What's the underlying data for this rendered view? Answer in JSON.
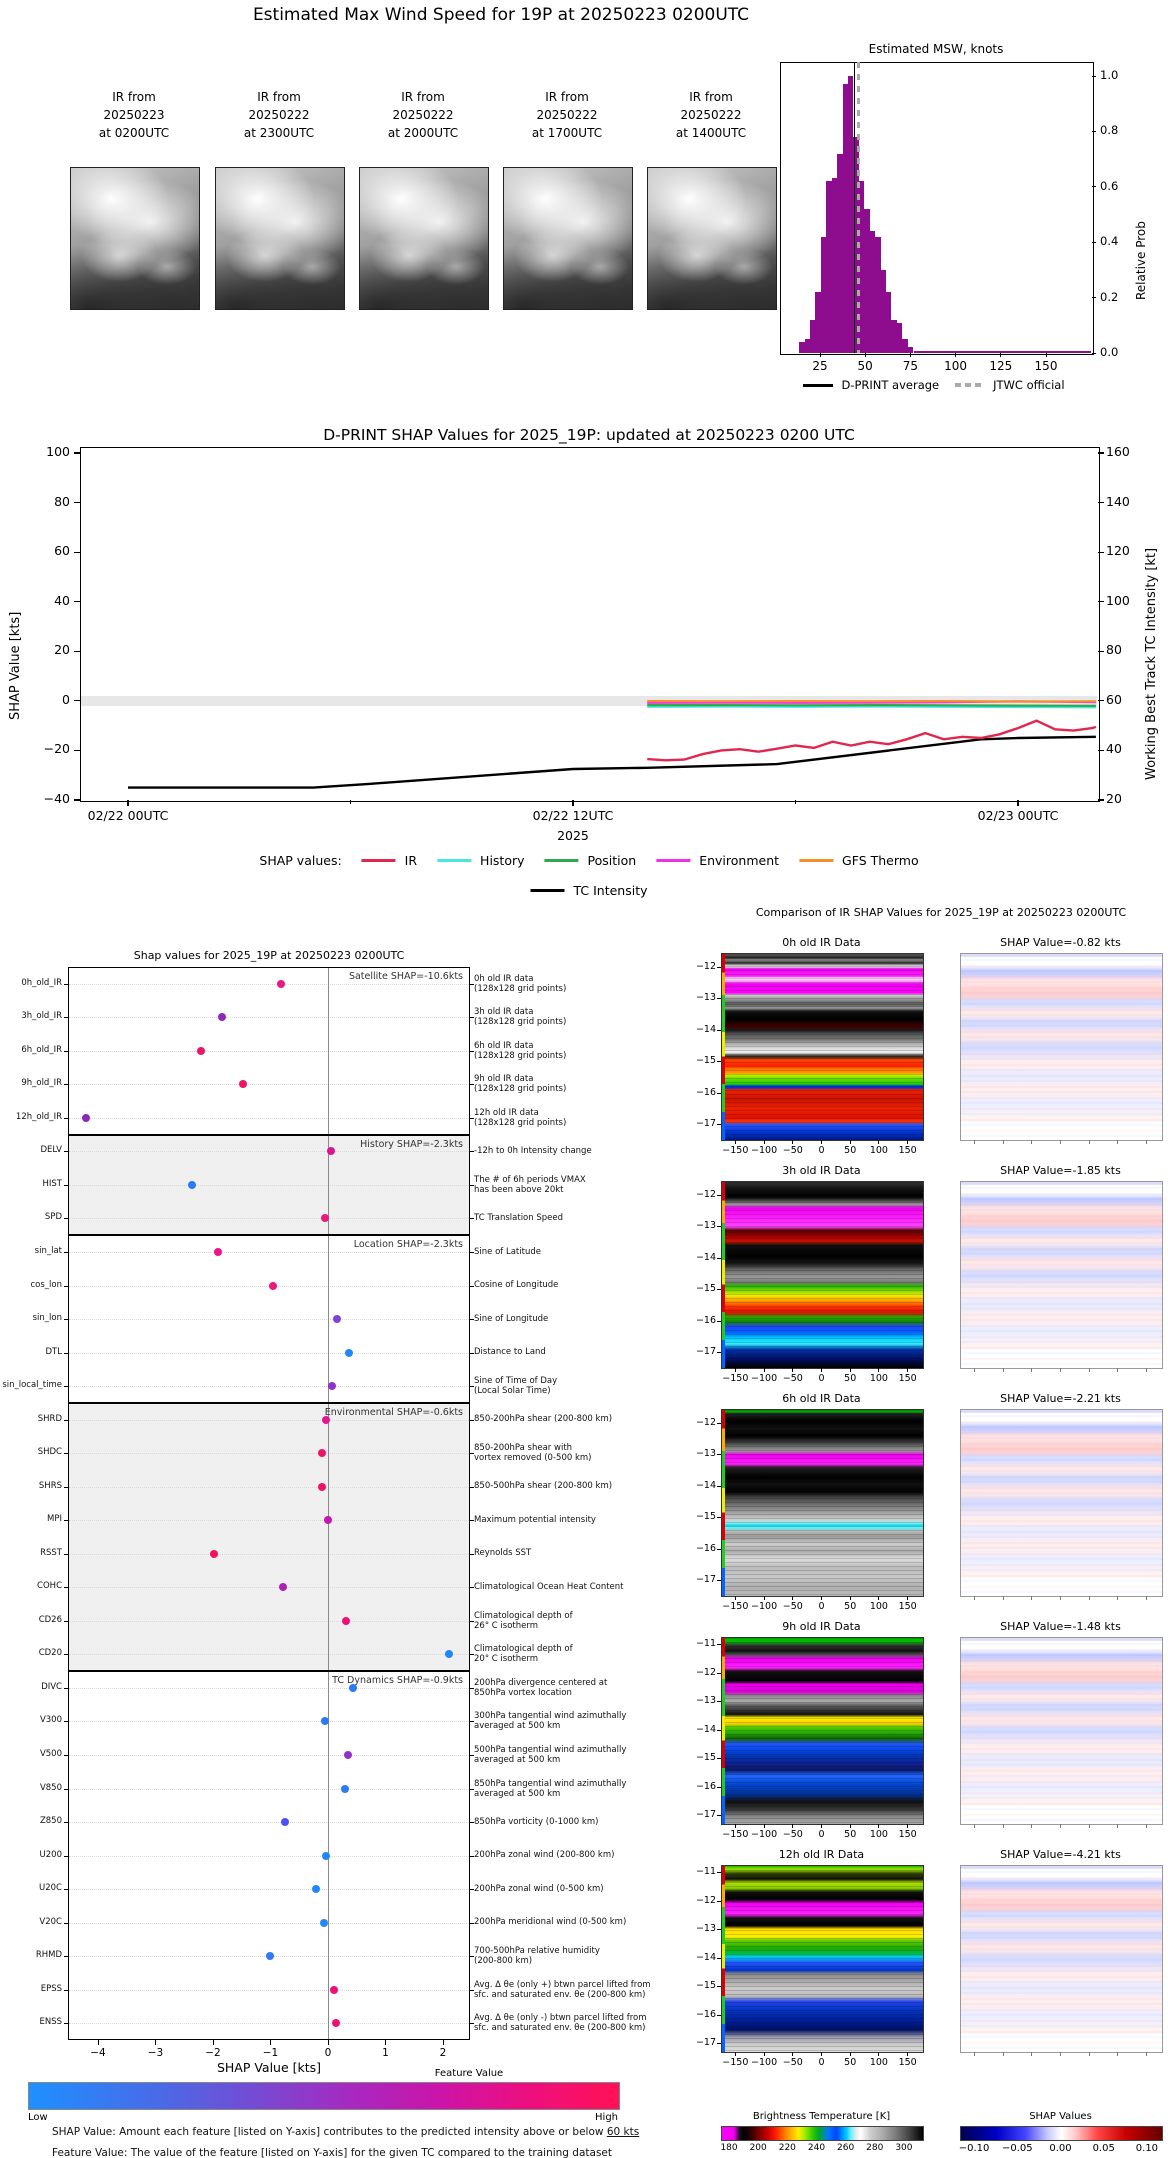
{
  "page": {
    "title": "Estimated Max Wind Speed for 19P at 20250223 0200UTC"
  },
  "ir_thumbnails": [
    {
      "label": "IR from\n20250223\nat 0200UTC"
    },
    {
      "label": "IR from\n20250222\nat 2300UTC"
    },
    {
      "label": "IR from\n20250222\nat 2000UTC"
    },
    {
      "label": "IR from\n20250222\nat 1700UTC"
    },
    {
      "label": "IR from\n20250222\nat 1400UTC"
    }
  ],
  "footer": {
    "feature_value_title": "Feature Value",
    "low": "Low",
    "high": "High",
    "shap_note_prefix": "SHAP Value: Amount each feature [listed on Y-axis] contributes to the predicted intensity above or below ",
    "shap_note_underlined": "60 kts",
    "feature_note": "Feature Value: The value of the feature [listed on Y-axis] for the given TC compared to the training dataset"
  },
  "chart_data": [
    {
      "id": "msw_histogram",
      "type": "bar",
      "title": "Estimated MSW, knots",
      "ylabel": "Relative Prob",
      "bar_color": "#8e0c8e",
      "xticks": [
        25,
        50,
        75,
        100,
        125,
        150
      ],
      "yticks": [
        "1.0",
        "0.8",
        "0.6",
        "0.4",
        "0.2",
        "0.0"
      ],
      "ytick_values": [
        1.0,
        0.8,
        0.6,
        0.4,
        0.2,
        0.0
      ],
      "xlim": [
        7,
        176
      ],
      "ylim": [
        0,
        1.05
      ],
      "bins": [
        {
          "x": 15,
          "p": 0.04
        },
        {
          "x": 18,
          "p": 0.05
        },
        {
          "x": 21,
          "p": 0.12
        },
        {
          "x": 24,
          "p": 0.22
        },
        {
          "x": 27,
          "p": 0.42
        },
        {
          "x": 30,
          "p": 0.62
        },
        {
          "x": 33,
          "p": 0.63
        },
        {
          "x": 36,
          "p": 0.72
        },
        {
          "x": 39,
          "p": 0.97
        },
        {
          "x": 42,
          "p": 1.0
        },
        {
          "x": 45,
          "p": 0.78
        },
        {
          "x": 48,
          "p": 0.62
        },
        {
          "x": 51,
          "p": 0.52
        },
        {
          "x": 54,
          "p": 0.44
        },
        {
          "x": 57,
          "p": 0.42
        },
        {
          "x": 60,
          "p": 0.3
        },
        {
          "x": 63,
          "p": 0.22
        },
        {
          "x": 66,
          "p": 0.12
        },
        {
          "x": 69,
          "p": 0.11
        },
        {
          "x": 72,
          "p": 0.05
        },
        {
          "x": 75,
          "p": 0.02
        }
      ],
      "tail": {
        "from": 77,
        "to": 175,
        "p": 0.008
      },
      "vlines": [
        {
          "label": "D-PRINT average",
          "x": 44,
          "style": "solid",
          "color": "#000000"
        },
        {
          "label": "JTWC official",
          "x": 46.5,
          "style": "dashed",
          "color": "#aaaaaa"
        }
      ],
      "legend": [
        {
          "label": "D-PRINT average",
          "style": "solid",
          "color": "#000000"
        },
        {
          "label": "JTWC official",
          "style": "dashed",
          "color": "#aaaaaa"
        }
      ]
    },
    {
      "id": "shap_timeseries",
      "type": "line",
      "title": "D-PRINT SHAP Values for 2025_19P: updated at 20250223 0200 UTC",
      "ylabel_left": "SHAP Value [kts]",
      "ylabel_right": "Working Best Track TC Intensity [kt]",
      "yticks_left": [
        "100",
        "80",
        "60",
        "40",
        "20",
        "0",
        "−20",
        "−40"
      ],
      "ytick_left_values": [
        100,
        80,
        60,
        40,
        20,
        0,
        -20,
        -40
      ],
      "yticks_right": [
        "160",
        "140",
        "120",
        "100",
        "80",
        "60",
        "40",
        "20"
      ],
      "ytick_right_values": [
        160,
        140,
        120,
        100,
        80,
        60,
        40,
        20
      ],
      "xticks": [
        {
          "h": 0,
          "label": "02/22 00UTC"
        },
        {
          "h": 12,
          "label": "02/22 12UTC"
        },
        {
          "h": 24,
          "label": "02/23 00UTC"
        }
      ],
      "minor_xticks_h": [
        6,
        18
      ],
      "xlabel": "2025",
      "x_hours_lim": [
        -1.3,
        26.1
      ],
      "zero_band_halfwidth_kts": 2,
      "legend_title": "SHAP values:",
      "series": [
        {
          "name": "IR",
          "color": "#e0274e",
          "axis": "left",
          "x_hours": [
            14,
            14.5,
            15,
            15.5,
            16,
            16.5,
            17,
            17.5,
            18,
            18.5,
            19,
            19.5,
            20,
            20.5,
            21,
            21.5,
            22,
            22.5,
            23,
            23.5,
            24,
            24.5,
            25,
            25.5,
            26,
            26.1
          ],
          "values": [
            -23.5,
            -24,
            -23.7,
            -21.5,
            -20,
            -19.5,
            -20.5,
            -19.3,
            -18,
            -19,
            -16.5,
            -18,
            -16.5,
            -17.5,
            -15.5,
            -13,
            -15.5,
            -14.5,
            -15,
            -13.5,
            -11,
            -8,
            -11.5,
            -12,
            -11,
            -10.5
          ]
        },
        {
          "name": "History",
          "color": "#45e8df",
          "axis": "left",
          "x_hours": [
            14,
            16,
            18,
            20,
            22,
            24,
            26.1
          ],
          "values": [
            -2.4,
            -2.3,
            -2.4,
            -2.3,
            -2.4,
            -2.5,
            -2.6
          ]
        },
        {
          "name": "Position",
          "color": "#2fa84f",
          "axis": "left",
          "x_hours": [
            14,
            16,
            18,
            20,
            22,
            24,
            26.1
          ],
          "values": [
            -1.7,
            -1.7,
            -1.8,
            -1.7,
            -1.8,
            -1.9,
            -2.0
          ]
        },
        {
          "name": "Environment",
          "color": "#ee2fee",
          "axis": "left",
          "x_hours": [
            14,
            16,
            18,
            20,
            22,
            24,
            26.1
          ],
          "values": [
            -0.8,
            -0.7,
            -0.8,
            -0.7,
            -0.6,
            -0.2,
            -0.5
          ]
        },
        {
          "name": "GFS Thermo",
          "color": "#f68c2c",
          "axis": "left",
          "x_hours": [
            14,
            16,
            18,
            20,
            22,
            24,
            26.1
          ],
          "values": [
            -0.1,
            -0.2,
            -0.1,
            -0.2,
            -0.1,
            -0.3,
            -0.2
          ]
        },
        {
          "name": "TC Intensity",
          "color": "#000000",
          "axis": "right",
          "x_hours": [
            0,
            5,
            6.5,
            12,
            14,
            17.5,
            23,
            24,
            26.1
          ],
          "values": [
            25,
            25,
            26.5,
            32.5,
            33,
            34.5,
            44.5,
            45,
            45.5
          ]
        }
      ]
    },
    {
      "id": "shap_dotplot",
      "type": "scatter",
      "title": "Shap values for 2025_19P at 20250223 0200UTC",
      "xlabel": "SHAP Value [kts]",
      "xtick_values": [
        -4,
        -3,
        -2,
        -1,
        0,
        1,
        2
      ],
      "xtick_labels": [
        "−4",
        "−3",
        "−2",
        "−1",
        "0",
        "1",
        "2"
      ],
      "xlim": [
        -4.5,
        2.45
      ],
      "sections": [
        {
          "label": "Satellite SHAP=-10.6kts",
          "rows": 5,
          "bg": "#ffffff"
        },
        {
          "label": "History SHAP=-2.3kts",
          "rows": 3,
          "bg": "#f0f0f0"
        },
        {
          "label": "Location SHAP=-2.3kts",
          "rows": 5,
          "bg": "#ffffff"
        },
        {
          "label": "Environmental SHAP=-0.6kts",
          "rows": 8,
          "bg": "#f0f0f0"
        },
        {
          "label": "TC Dynamics SHAP=-0.9kts",
          "rows": 11,
          "bg": "#ffffff"
        }
      ],
      "rows": [
        {
          "feature": "0h_old_IR",
          "shap": -0.82,
          "dot_color": "#e9197f",
          "desc": "0h old IR data\n(128x128 grid points)"
        },
        {
          "feature": "3h_old_IR",
          "shap": -1.85,
          "dot_color": "#8d28b8",
          "desc": "3h old IR data\n(128x128 grid points)"
        },
        {
          "feature": "6h_old_IR",
          "shap": -2.21,
          "dot_color": "#ed1566",
          "desc": "6h old IR data\n(128x128 grid points)"
        },
        {
          "feature": "9h_old_IR",
          "shap": -1.48,
          "dot_color": "#ed1566",
          "desc": "9h old IR data\n(128x128 grid points)"
        },
        {
          "feature": "12h_old_IR",
          "shap": -4.21,
          "dot_color": "#8d28b8",
          "desc": "12h old IR data\n(128x128 grid points)"
        },
        {
          "feature": "DELV",
          "shap": 0.06,
          "dot_color": "#dc1490",
          "desc": "-12h to 0h Intensity change"
        },
        {
          "feature": "HIST",
          "shap": -2.36,
          "dot_color": "#2b7bf5",
          "desc": "The # of 6h periods VMAX\nhas been above 20kt"
        },
        {
          "feature": "SPD",
          "shap": -0.05,
          "dot_color": "#e9197f",
          "desc": "TC Translation Speed"
        },
        {
          "feature": "sin_lat",
          "shap": -1.91,
          "dot_color": "#ed138c",
          "desc": "Sine of Latitude"
        },
        {
          "feature": "cos_lon",
          "shap": -0.96,
          "dot_color": "#e9197f",
          "desc": "Cosine of Longitude"
        },
        {
          "feature": "sin_lon",
          "shap": 0.16,
          "dot_color": "#7d42d8",
          "desc": "Sine of Longitude"
        },
        {
          "feature": "DTL",
          "shap": 0.37,
          "dot_color": "#2288fa",
          "desc": "Distance to Land"
        },
        {
          "feature": "sin_local_time",
          "shap": 0.07,
          "dot_color": "#9332c8",
          "desc": "Sine of Time of Day\n(Local Solar Time)"
        },
        {
          "feature": "SHRD",
          "shap": -0.04,
          "dot_color": "#e2188f",
          "desc": "850-200hPa shear (200-800 km)"
        },
        {
          "feature": "SHDC",
          "shap": -0.11,
          "dot_color": "#ed1566",
          "desc": "850-200hPa shear with\nvortex removed (0-500 km)"
        },
        {
          "feature": "SHRS",
          "shap": -0.11,
          "dot_color": "#ed1566",
          "desc": "850-500hPa shear (200-800 km)"
        },
        {
          "feature": "MPI",
          "shap": 0.0,
          "dot_color": "#c318b4",
          "desc": "Maximum potential intensity"
        },
        {
          "feature": "RSST",
          "shap": -1.98,
          "dot_color": "#f01160",
          "desc": "Reynolds SST"
        },
        {
          "feature": "COHC",
          "shap": -0.79,
          "dot_color": "#aa22b4",
          "desc": "Climatological Ocean Heat Content"
        },
        {
          "feature": "CD26",
          "shap": 0.31,
          "dot_color": "#ed1177",
          "desc": "Climatological depth of\n26° C isotherm"
        },
        {
          "feature": "CD20",
          "shap": 2.11,
          "dot_color": "#2288fa",
          "desc": "Climatological depth of\n20° C isotherm"
        },
        {
          "feature": "DIVC",
          "shap": 0.43,
          "dot_color": "#2b7bf5",
          "desc": "200hPa divergence centered at\n850hPa vortex location"
        },
        {
          "feature": "V300",
          "shap": -0.06,
          "dot_color": "#2b7bf5",
          "desc": "300hPa tangential wind azimuthally\naveraged at 500 km"
        },
        {
          "feature": "V500",
          "shap": 0.34,
          "dot_color": "#9332c8",
          "desc": "500hPa tangential wind azimuthally\naveraged at 500 km"
        },
        {
          "feature": "V850",
          "shap": 0.3,
          "dot_color": "#2b7bf5",
          "desc": "850hPa tangential wind azimuthally\naveraged at 500 km"
        },
        {
          "feature": "Z850",
          "shap": -0.75,
          "dot_color": "#4a53ee",
          "desc": "850hPa vorticity (0-1000 km)"
        },
        {
          "feature": "U200",
          "shap": -0.03,
          "dot_color": "#2288fa",
          "desc": "200hPa zonal wind (200-800 km)"
        },
        {
          "feature": "U20C",
          "shap": -0.21,
          "dot_color": "#2288fa",
          "desc": "200hPa zonal wind (0-500 km)"
        },
        {
          "feature": "V20C",
          "shap": -0.07,
          "dot_color": "#2288fa",
          "desc": "200hPa meridional wind (0-500 km)"
        },
        {
          "feature": "RHMD",
          "shap": -1.01,
          "dot_color": "#2b7bf5",
          "desc": "700-500hPa relative humidity\n(200-800 km)"
        },
        {
          "feature": "EPSS",
          "shap": 0.1,
          "dot_color": "#ed1177",
          "desc": "Avg. Δ θe (only +) btwn parcel lifted from\nsfc. and saturated env. θe (200-800 km)"
        },
        {
          "feature": "ENSS",
          "shap": 0.14,
          "dot_color": "#ed1177",
          "desc": "Avg. Δ θe (only -) btwn parcel lifted from\nsfc. and saturated env. θe (200-800 km)"
        }
      ]
    },
    {
      "id": "ir_shap_comparison",
      "type": "heatmap",
      "title": "Comparison of IR SHAP Values for 2025_19P at 20250223 0200UTC",
      "xtick_values": [
        -150,
        -100,
        -50,
        0,
        50,
        100,
        150
      ],
      "xtick_labels": [
        "−150",
        "−100",
        "−50",
        "0",
        "50",
        "100",
        "150"
      ],
      "rows": [
        {
          "left_title": "0h old IR Data",
          "right_title": "SHAP Value=-0.82 kts",
          "yticks": [
            "−12",
            "−13",
            "−14",
            "−15",
            "−16",
            "−17"
          ]
        },
        {
          "left_title": "3h old IR Data",
          "right_title": "SHAP Value=-1.85 kts",
          "yticks": [
            "−12",
            "−13",
            "−14",
            "−15",
            "−16",
            "−17"
          ]
        },
        {
          "left_title": "6h old IR Data",
          "right_title": "SHAP Value=-2.21 kts",
          "yticks": [
            "−12",
            "−13",
            "−14",
            "−15",
            "−16",
            "−17"
          ]
        },
        {
          "left_title": "9h old IR Data",
          "right_title": "SHAP Value=-1.48 kts",
          "yticks": [
            "−11",
            "−12",
            "−13",
            "−14",
            "−15",
            "−16",
            "−17"
          ]
        },
        {
          "left_title": "12h old IR Data",
          "right_title": "SHAP Value=-4.21 kts",
          "yticks": [
            "−11",
            "−12",
            "−13",
            "−14",
            "−15",
            "−16",
            "−17"
          ]
        }
      ],
      "colorbars": [
        {
          "title": "Brightness Temperature [K]",
          "tick_values": [
            180,
            200,
            220,
            240,
            260,
            280,
            300
          ],
          "tick_labels": [
            "180",
            "200",
            "220",
            "240",
            "260",
            "280",
            "300"
          ]
        },
        {
          "title": "SHAP Values",
          "tick_values": [
            -0.1,
            -0.05,
            0,
            0.05,
            0.1
          ],
          "tick_labels": [
            "−0.10",
            "−0.05",
            "0.00",
            "0.05",
            "0.10"
          ]
        }
      ]
    }
  ]
}
